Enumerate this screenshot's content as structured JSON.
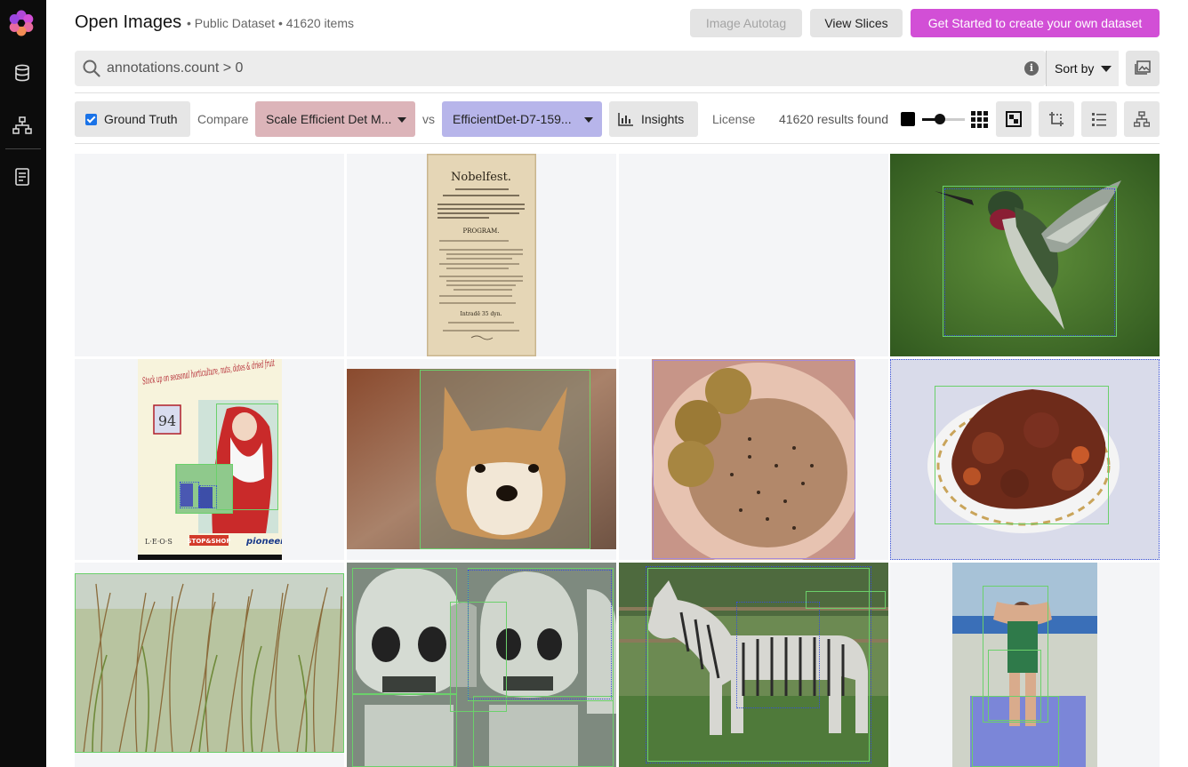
{
  "header": {
    "title": "Open Images",
    "subtitle": "• Public Dataset • 41620 items",
    "autotag_label": "Image Autotag",
    "slices_label": "View Slices",
    "start_label": "Get Started to create your own dataset"
  },
  "search": {
    "query": "annotations.count > 0",
    "sort_label": "Sort by"
  },
  "toolbar": {
    "ground_truth_label": "Ground Truth",
    "ground_truth_checked": true,
    "compare_label": "Compare",
    "model_a": "Scale Efficient Det M...",
    "vs_label": "vs",
    "model_b": "EfficientDet-D7-159...",
    "insights_label": "Insights",
    "license_label": "License",
    "results_text": "41620 results found"
  },
  "colors": {
    "accent": "#d24fd6",
    "model_a": "#dcb4b9",
    "model_b": "#b7b5ea",
    "ground_truth_box": "#6bd06b",
    "prediction_box": "#3850d8"
  },
  "document_image": {
    "title": "Nobelfest.",
    "program": "PROGRAM.",
    "intermission": "Intradē 35 dyn."
  },
  "poster_image": {
    "headline": "Stock up on seasonal horticulture, nuts, dates & dried fruit",
    "badge": "94",
    "footer_left": "L·E·O·S",
    "footer_mid": "STOP&SHOP",
    "footer_right": "pioneer"
  },
  "icons": {
    "logo": "flower-logo-icon",
    "nav": [
      "database-icon",
      "hierarchy-icon",
      "document-icon"
    ]
  }
}
